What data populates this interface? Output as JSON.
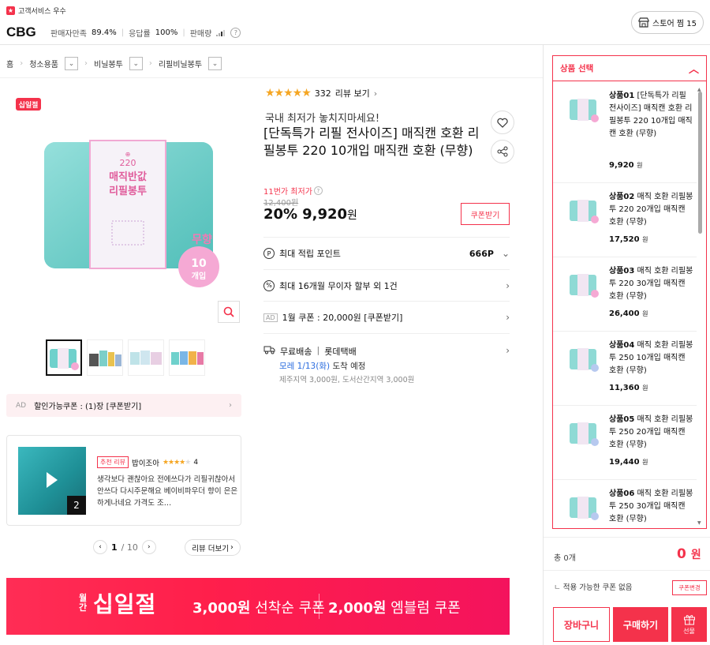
{
  "colors": {
    "accent": "#f4324b",
    "star": "#f5a623",
    "link": "#2a6cdf"
  },
  "seller": {
    "badge": "고객서비스 우수",
    "name": "CBG",
    "satisfaction_label": "판매자만족",
    "satisfaction_value": "89.4%",
    "response_label": "응답률",
    "response_value": "100%",
    "sales_label": "판매량",
    "store_button": "스토어 찜 15"
  },
  "breadcrumb": [
    "홈",
    "청소용품",
    "비닐봉투",
    "리필비닐봉투"
  ],
  "gallery": {
    "tag": "십일절",
    "image_text_top": "220",
    "image_text_title": "매직반값 리필봉투",
    "image_badge": "무향",
    "image_count": "10",
    "image_count_unit": "개입"
  },
  "coupon_banner": {
    "ad": "AD",
    "text": "할인가능쿠폰 : (1)장 [쿠폰받기]"
  },
  "review": {
    "video_count": "2",
    "tag": "추천 리뷰",
    "author": "밥이조아",
    "rating": "4",
    "text": "생각보다 괜찮아요 전에쓰다가 리필귀찮아서 안쓰다 다시주문해요 베이비파우더 향이 은은하게나네요 가격도 조…",
    "page_current": "1",
    "page_total": "/ 10",
    "more_button": "리뷰 더보기"
  },
  "product": {
    "review_count": "332",
    "review_link": "리뷰 보기",
    "subtitle": "국내 최저가 놓치지마세요!",
    "title": "[단독특가 리필 전사이즈] 매직캔 호환 리필봉투 220 10개입 매직캔 호환 (무향)",
    "lowest_label": "11번가 최저가",
    "original_price": "12,400원",
    "discount": "20%",
    "price": "9,920",
    "price_unit": "원",
    "coupon_button": "쿠폰받기"
  },
  "info_rows": {
    "point_label": "최대 적립 포인트",
    "point_value": "666P",
    "install": "최대 16개월 무이자 할부 외 1건",
    "month_coupon_ad": "AD",
    "month_coupon": "1월 쿠폰 : 20,000원 [쿠폰받기]",
    "ship_label": "무료배송",
    "ship_carrier": "롯데택배",
    "ship_date": "모레 1/13(화)",
    "ship_date_rest": "도착 예정",
    "ship_extra": "제주지역 3,000원, 도서산간지역 3,000원"
  },
  "option_panel": {
    "header": "상품 선택",
    "items": [
      {
        "code": "상품01",
        "name": "[단독특가 리필 전사이즈] 매직캔 호환 리필봉투 220 10개입 매직캔 호환 (무향)",
        "price": "9,920",
        "unit": "원"
      },
      {
        "code": "상품02",
        "name": "매직 호환 리필봉투 220 20개입 매직캔 호환 (무향)",
        "price": "17,520",
        "unit": "원"
      },
      {
        "code": "상품03",
        "name": "매직 호환 리필봉투 220 30개입 매직캔 호환 (무향)",
        "price": "26,400",
        "unit": "원"
      },
      {
        "code": "상품04",
        "name": "매직 호환 리필봉투 250 10개입 매직캔 호환 (무향)",
        "price": "11,360",
        "unit": "원"
      },
      {
        "code": "상품05",
        "name": "매직 호환 리필봉투 250 20개입 매직캔 호환 (무향)",
        "price": "19,440",
        "unit": "원"
      },
      {
        "code": "상품06",
        "name": "매직 호환 리필봉투 250 30개입 매직캔 호환 (무향)",
        "price": "",
        "unit": ""
      }
    ],
    "total_count": "총 0개",
    "total_price": "0",
    "total_unit": "원",
    "coupon_none": "적용 가능한 쿠폰 없음",
    "coupon_change": "쿠폰변경",
    "cart": "장바구니",
    "buy": "구매하기",
    "gift": "선물"
  },
  "promo": {
    "logo_small": "월간",
    "logo_big": "십일절",
    "c1_bold": "3,000원",
    "c1_rest": "선착순 쿠폰",
    "c2_bold": "2,000원",
    "c2_rest": "엠블럼 쿠폰"
  }
}
